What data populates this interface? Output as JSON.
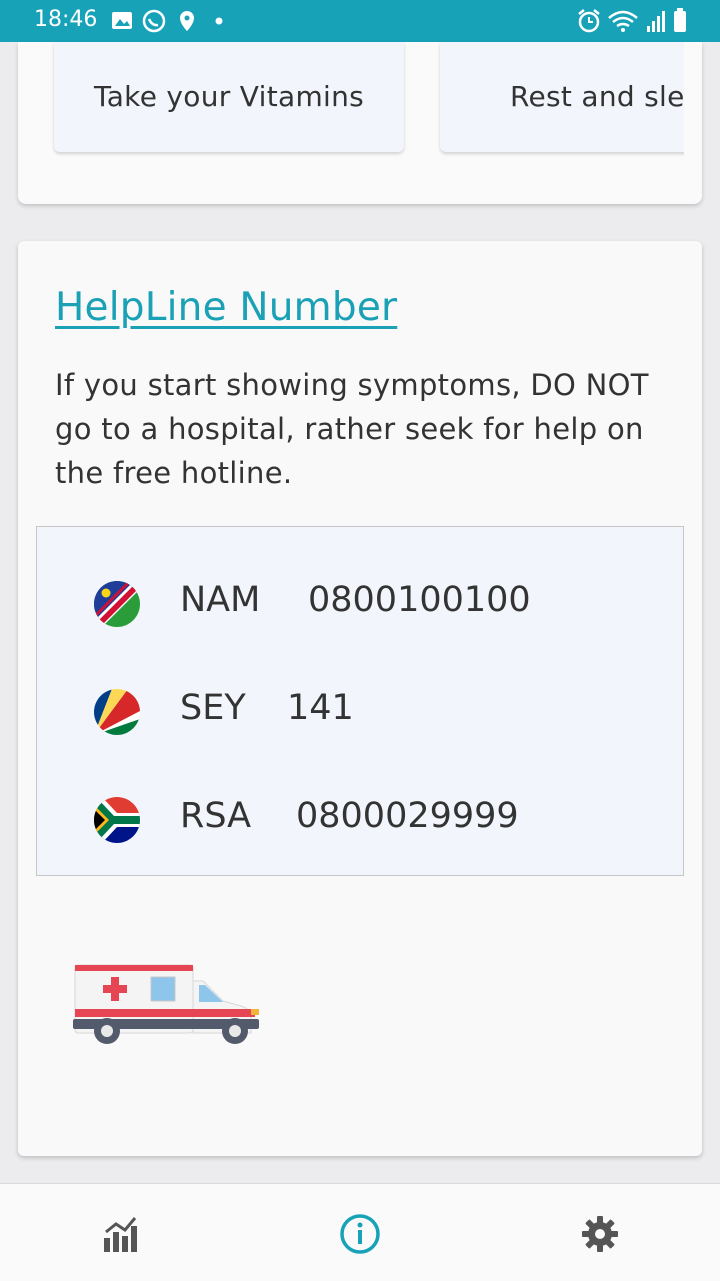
{
  "status_bar": {
    "time": "18:46",
    "left_icons": [
      "image-icon",
      "whatsapp-icon",
      "location-icon",
      "dot-icon"
    ],
    "right_icons": [
      "alarm-icon",
      "wifi-icon",
      "signal-icon",
      "battery-icon"
    ]
  },
  "tips": [
    {
      "label": "Take your Vitamins"
    },
    {
      "label": "Rest and sle"
    }
  ],
  "helpline": {
    "title": "HelpLine Number",
    "description": "If you start showing symptoms, DO NOT go to a hospital, rather seek for help on the free hotline.",
    "entries": [
      {
        "code": "NAM",
        "number": "0800100100",
        "flag": "namibia-flag"
      },
      {
        "code": "SEY",
        "number": "141",
        "flag": "seychelles-flag"
      },
      {
        "code": "RSA",
        "number": "0800029999",
        "flag": "south-africa-flag"
      }
    ]
  },
  "bottom_nav": {
    "items": [
      {
        "icon": "stats-icon",
        "active": false
      },
      {
        "icon": "info-icon",
        "active": true
      },
      {
        "icon": "settings-icon",
        "active": false
      }
    ],
    "active_color": "#17a2b8",
    "inactive_color": "#555555"
  },
  "colors": {
    "accent": "#17a2b8"
  }
}
